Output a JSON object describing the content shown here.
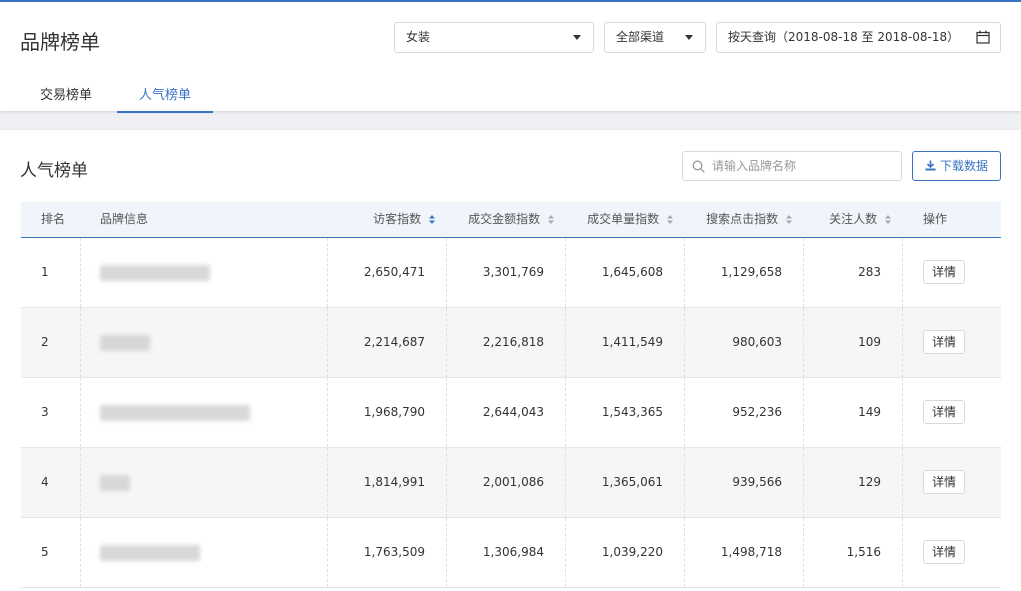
{
  "header": {
    "title": "品牌榜单",
    "category_select": "女装",
    "channel_select": "全部渠道",
    "date_range": "按天查询（2018-08-18 至 2018-08-18）",
    "tabs": [
      "交易榜单",
      "人气榜单"
    ],
    "active_tab": "人气榜单"
  },
  "section": {
    "title": "人气榜单",
    "search_placeholder": "请输入品牌名称",
    "download_label": "下载数据"
  },
  "table": {
    "columns": [
      "排名",
      "品牌信息",
      "访客指数",
      "成交金额指数",
      "成交单量指数",
      "搜索点击指数",
      "关注人数",
      "操作"
    ],
    "sorted_column": "访客指数",
    "detail_label": "详情",
    "rows": [
      {
        "rank": "1",
        "visitor": "2,650,471",
        "amount": "3,301,769",
        "orders": "1,645,608",
        "search_click": "1,129,658",
        "followers": "283"
      },
      {
        "rank": "2",
        "visitor": "2,214,687",
        "amount": "2,216,818",
        "orders": "1,411,549",
        "search_click": "980,603",
        "followers": "109"
      },
      {
        "rank": "3",
        "visitor": "1,968,790",
        "amount": "2,644,043",
        "orders": "1,543,365",
        "search_click": "952,236",
        "followers": "149"
      },
      {
        "rank": "4",
        "visitor": "1,814,991",
        "amount": "2,001,086",
        "orders": "1,365,061",
        "search_click": "939,566",
        "followers": "129"
      },
      {
        "rank": "5",
        "visitor": "1,763,509",
        "amount": "1,306,984",
        "orders": "1,039,220",
        "search_click": "1,498,718",
        "followers": "1,516"
      }
    ]
  },
  "colors": {
    "accent": "#3b73c4",
    "header_bg": "#f0f4fb",
    "row_alt_bg": "#f5f6f7"
  }
}
